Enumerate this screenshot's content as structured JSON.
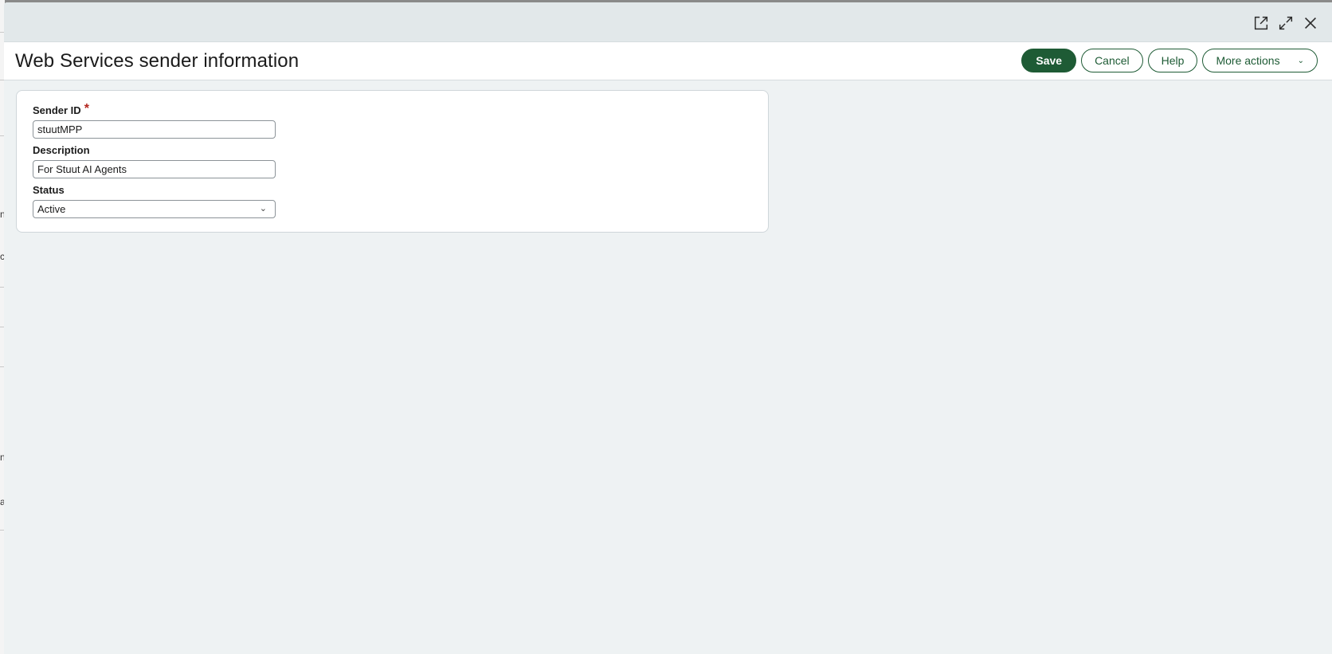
{
  "window": {
    "icons": [
      "open-in-new-window-icon",
      "expand-icon",
      "close-icon"
    ]
  },
  "header": {
    "title": "Web Services sender information",
    "buttons": {
      "save": "Save",
      "cancel": "Cancel",
      "help": "Help",
      "more_actions": "More actions"
    }
  },
  "form": {
    "sender_id": {
      "label": "Sender ID",
      "required_mark": "*",
      "value": "stuutMPP"
    },
    "description": {
      "label": "Description",
      "value": "For Stuut AI Agents"
    },
    "status": {
      "label": "Status",
      "value": "Active"
    }
  },
  "background": {
    "glyphs": [
      "n",
      "c",
      "n",
      "a"
    ]
  },
  "colors": {
    "accent": "#1e5b35",
    "required": "#b3261e",
    "modal_bg": "#eef2f3",
    "topbar_bg": "#e2e8ea"
  }
}
